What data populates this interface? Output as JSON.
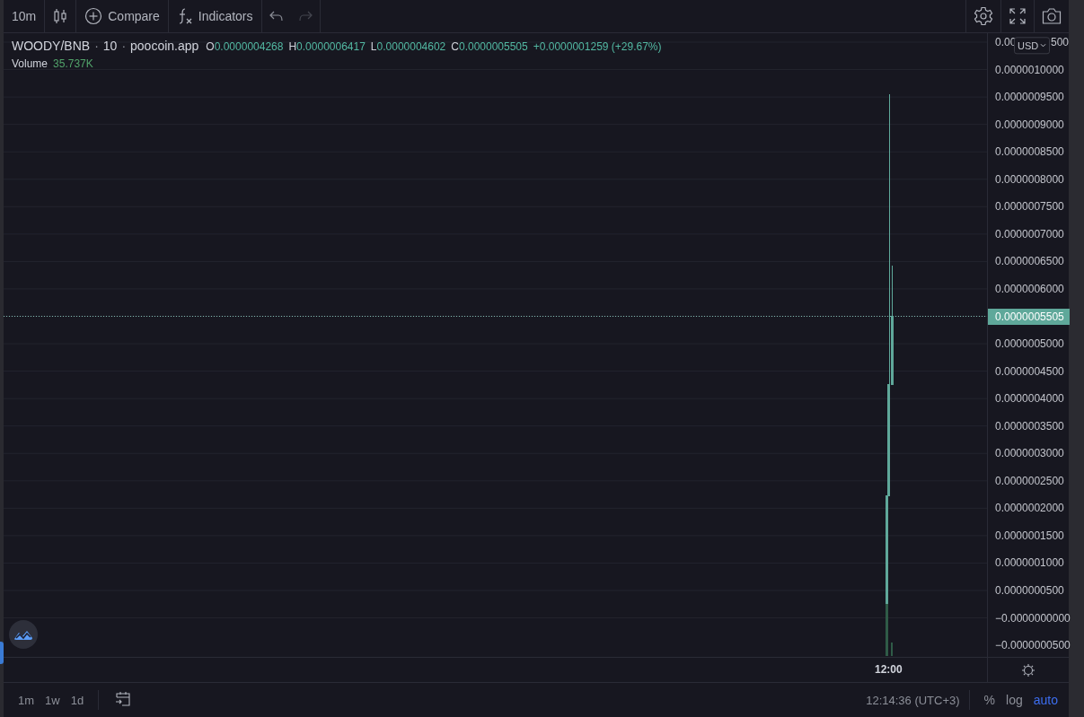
{
  "toolbar": {
    "interval": "10m",
    "compare": "Compare",
    "indicators": "Indicators",
    "undo": {
      "disabled": false
    },
    "redo": {
      "disabled": true
    }
  },
  "legend": {
    "symbol": "WOODY/BNB",
    "interval": "10",
    "source": "poocoin.app",
    "separator": "·",
    "ohlc": [
      {
        "label": "O",
        "value": "0.0000004268"
      },
      {
        "label": "H",
        "value": "0.0000006417"
      },
      {
        "label": "L",
        "value": "0.0000004602"
      },
      {
        "label": "C",
        "value": "0.0000005505"
      }
    ],
    "change": "+0.0000001259 (+29.67%)"
  },
  "volume": {
    "label": "Volume",
    "value": "35.737K"
  },
  "price_axis": {
    "currency": "USD",
    "top_label_parts": [
      "0.00",
      "500"
    ],
    "labels": [
      "0.0000010000",
      "0.0000009500",
      "0.0000009000",
      "0.0000008500",
      "0.0000008000",
      "0.0000007500",
      "0.0000007000",
      "0.0000006500",
      "0.0000006000",
      "0.0000005000",
      "0.0000004500",
      "0.0000004000",
      "0.0000003500",
      "0.0000003000",
      "0.0000002500",
      "0.0000002000",
      "0.0000001500",
      "0.0000001000",
      "0.0000000500",
      "−0.0000000000",
      "−0.0000000500"
    ],
    "last_price": "0.0000005505"
  },
  "time_axis": {
    "labels": [
      "12:00"
    ]
  },
  "bottom_bar": {
    "ranges": [
      {
        "label": "1m",
        "selected": false
      },
      {
        "label": "1w",
        "selected": false
      },
      {
        "label": "1d",
        "selected": false
      }
    ],
    "clock": "12:14:36 (UTC+3)",
    "scale_options": [
      {
        "label": "%",
        "selected": false
      },
      {
        "label": "log",
        "selected": false
      },
      {
        "label": "auto",
        "selected": true
      }
    ]
  }
}
